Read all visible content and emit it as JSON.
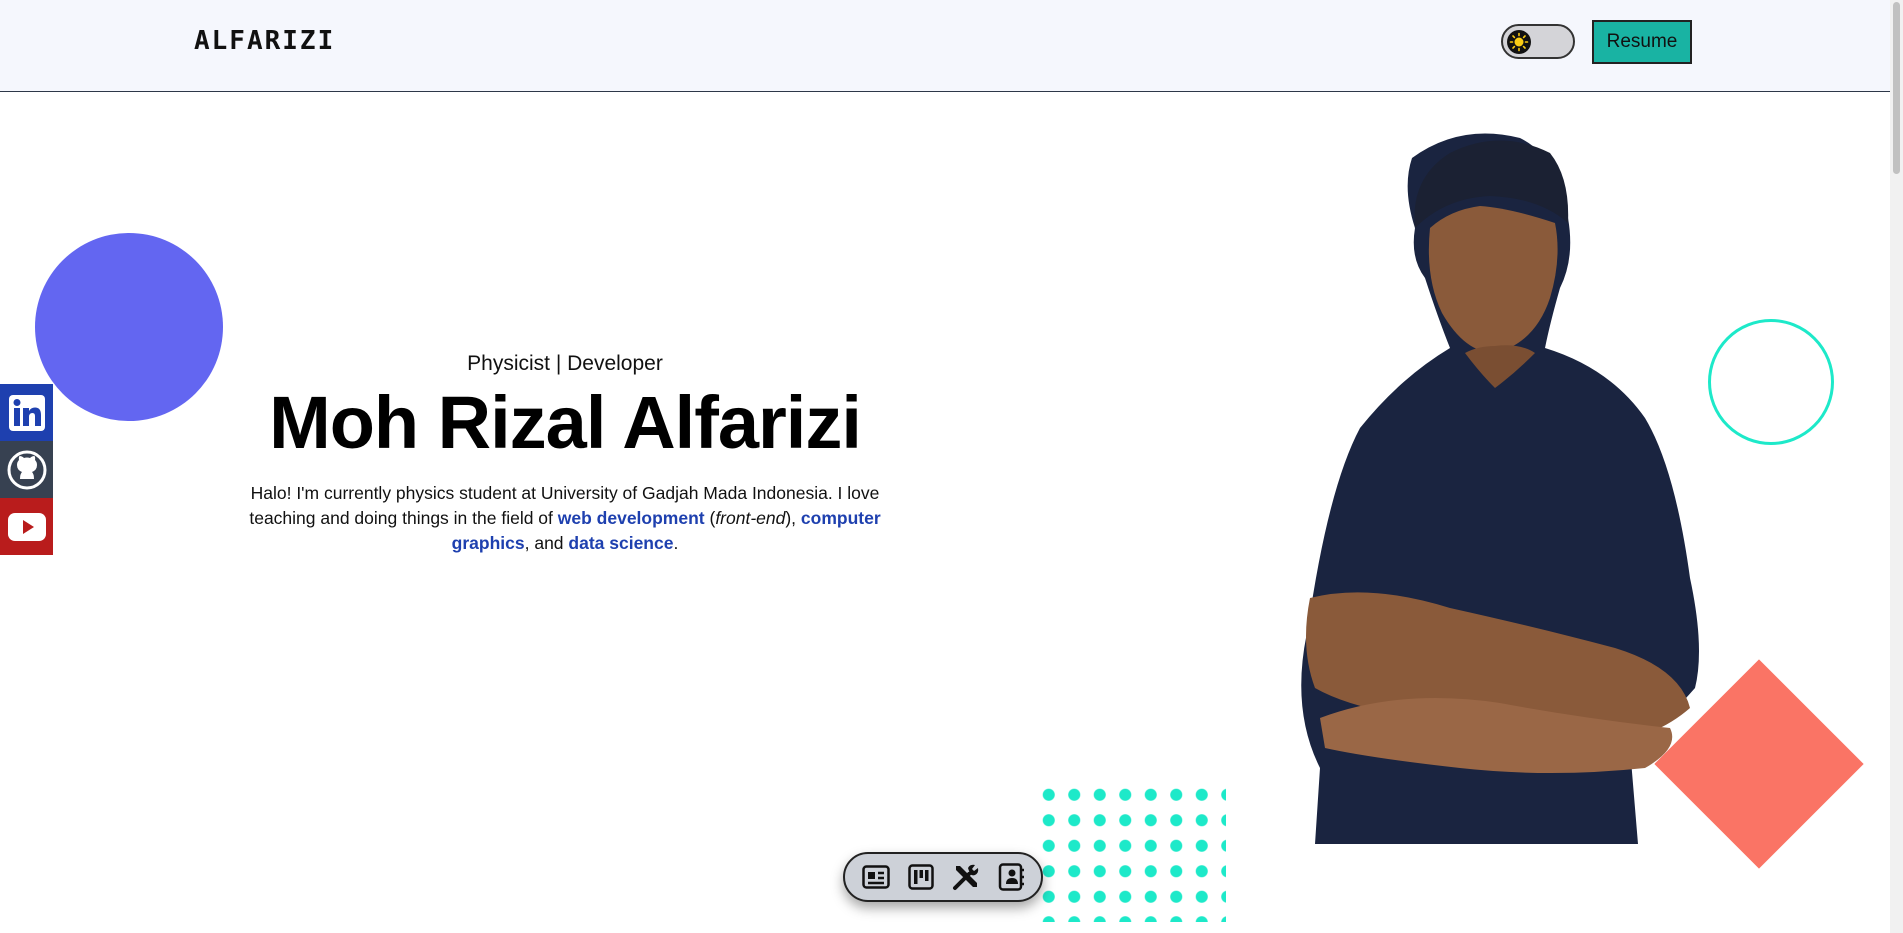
{
  "header": {
    "logo": "ALFARIZI",
    "resume_label": "Resume"
  },
  "theme_toggle": {
    "state": "light",
    "icon": "sun-icon"
  },
  "social": [
    {
      "name": "LinkedIn",
      "icon": "linkedin-icon",
      "color": "#1e40af"
    },
    {
      "name": "GitHub",
      "icon": "github-icon",
      "color": "#374151"
    },
    {
      "name": "YouTube",
      "icon": "youtube-icon",
      "color": "#b91c1c"
    }
  ],
  "hero": {
    "subtitle": "Physicist | Developer",
    "name": "Moh Rizal Alfarizi",
    "bio": {
      "part1": "Halo! I'm currently physics student at University of Gadjah Mada Indonesia. I love teaching and doing things in the field of ",
      "link1": "web development",
      "part2": " (",
      "emph": "front-end",
      "part3": "), ",
      "link2": "computer graphics",
      "part4": ", and ",
      "link3": "data science",
      "part5": "."
    }
  },
  "dock": [
    {
      "icon": "news-icon"
    },
    {
      "icon": "kanban-icon"
    },
    {
      "icon": "tools-icon"
    },
    {
      "icon": "contact-card-icon"
    }
  ],
  "colors": {
    "accent": "#19b3a3",
    "link": "#1e40af",
    "blue_circle": "#6366f1",
    "teal": "#1de9c9",
    "coral": "#fa7465"
  }
}
